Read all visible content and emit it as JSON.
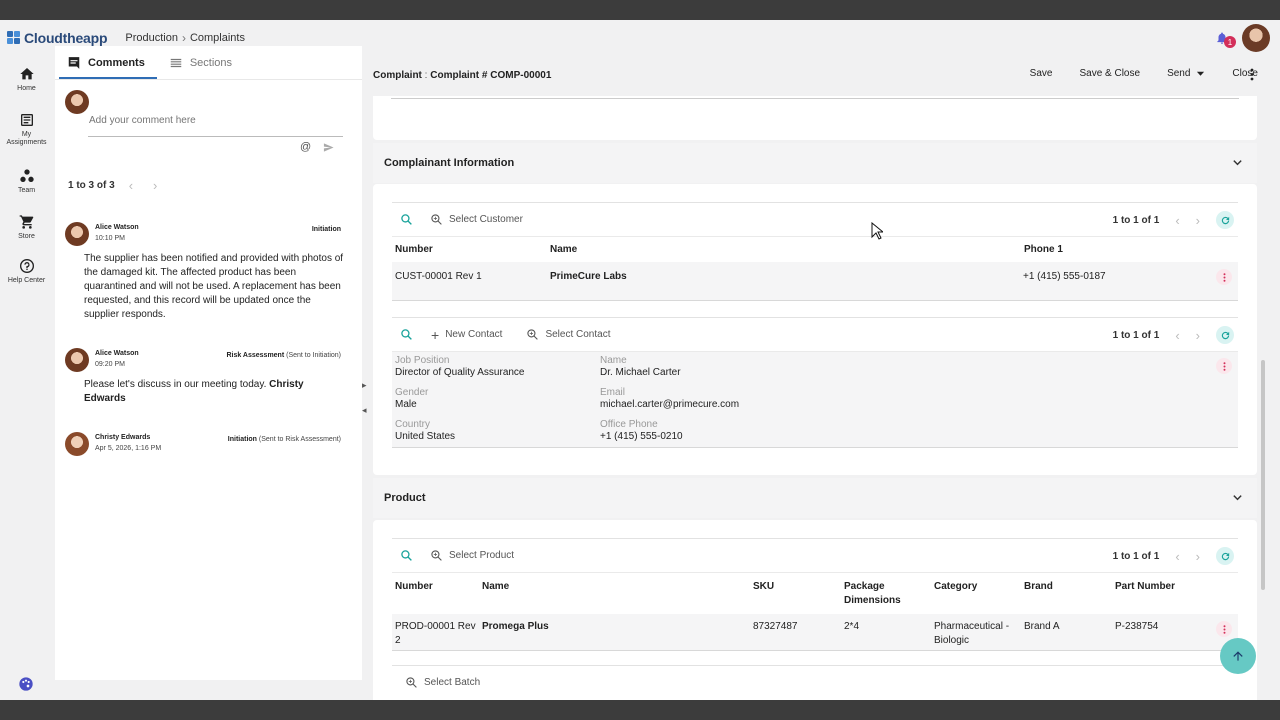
{
  "app": {
    "name": "Cloudtheapp",
    "breadcrumb": [
      "Production",
      "Complaints"
    ],
    "notification_count": "1"
  },
  "nav": [
    {
      "label": "Home",
      "icon": "home-icon"
    },
    {
      "label": "My Assignments",
      "icon": "assignments-icon"
    },
    {
      "label": "Team",
      "icon": "team-icon"
    },
    {
      "label": "Store",
      "icon": "store-icon"
    },
    {
      "label": "Help Center",
      "icon": "help-icon"
    }
  ],
  "comments_panel": {
    "tabs": [
      {
        "label": "Comments"
      },
      {
        "label": "Sections"
      }
    ],
    "input_placeholder": "Add your comment here",
    "mention_symbol": "@",
    "pager": "1 to 3 of 3",
    "items": [
      {
        "author": "Alice Watson",
        "time": "10:10 PM",
        "stage": "Initiation",
        "stage_sub": "",
        "text": "The supplier has been notified and provided with photos of the damaged kit. The affected product has been quarantined and will not be used. A replacement has been requested, and this record will be updated once the supplier responds."
      },
      {
        "author": "Alice Watson",
        "time": "09:20 PM",
        "stage": "Risk Assessment",
        "stage_sub": "(Sent to Initiation)",
        "text": "Please let's discuss in our meeting today. ",
        "mention": "Christy Edwards"
      },
      {
        "author": "Christy Edwards",
        "time": "Apr 5, 2026, 1:16 PM",
        "stage": "Initiation",
        "stage_sub": "(Sent to Risk Assessment)",
        "text": ""
      }
    ]
  },
  "record": {
    "title_prefix": "Complaint",
    "title_sep": ":",
    "title": "Complaint # COMP-00001",
    "actions": {
      "save": "Save",
      "save_close": "Save & Close",
      "send": "Send",
      "close": "Close"
    }
  },
  "complainant": {
    "section_title": "Complainant Information",
    "customer": {
      "select_label": "Select Customer",
      "pager": "1 to 1 of 1",
      "columns": [
        "Number",
        "Name",
        "Phone 1"
      ],
      "rows": [
        {
          "number": "CUST-00001 Rev 1",
          "name": "PrimeCure Labs",
          "phone": "+1 (415) 555-0187"
        }
      ]
    },
    "contact": {
      "new_label": "New Contact",
      "select_label": "Select Contact",
      "pager": "1 to 1 of 1",
      "fields": {
        "job_position": {
          "label": "Job Position",
          "value": "Director of Quality Assurance"
        },
        "name": {
          "label": "Name",
          "value": "Dr. Michael Carter"
        },
        "gender": {
          "label": "Gender",
          "value": "Male"
        },
        "email": {
          "label": "Email",
          "value": "michael.carter@primecure.com"
        },
        "country": {
          "label": "Country",
          "value": "United States"
        },
        "office_phone": {
          "label": "Office Phone",
          "value": "+1 (415) 555-0210"
        }
      }
    }
  },
  "product": {
    "section_title": "Product",
    "select_label": "Select Product",
    "pager": "1 to 1 of 1",
    "columns": [
      "Number",
      "Name",
      "SKU",
      "Package Dimensions",
      "Category",
      "Brand",
      "Part Number"
    ],
    "rows": [
      {
        "number": "PROD-00001 Rev 2",
        "name": "Promega Plus",
        "sku": "87327487",
        "dims": "2*4",
        "category": "Pharmaceutical - Biologic",
        "brand": "Brand A",
        "part": "P-238754"
      }
    ],
    "batch_label": "Select Batch"
  },
  "colors": {
    "accent": "#2f6db5",
    "teal": "#1aa39b",
    "pink": "#d32f5a"
  }
}
